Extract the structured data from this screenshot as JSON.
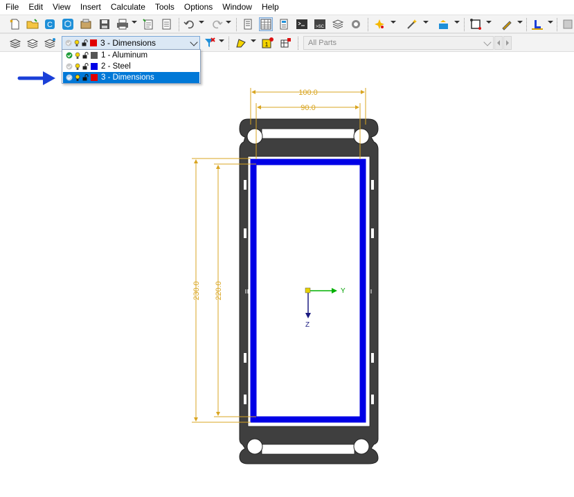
{
  "menu": [
    "File",
    "Edit",
    "View",
    "Insert",
    "Calculate",
    "Tools",
    "Options",
    "Window",
    "Help"
  ],
  "layer_combo": {
    "selected_label": "3 - Dimensions",
    "selected_color": "#e00000"
  },
  "layers": [
    {
      "label": "1 - Aluminum",
      "color": "#555555",
      "visible": true,
      "selected": false
    },
    {
      "label": "2 - Steel",
      "color": "#0000e6",
      "visible": false,
      "selected": false
    },
    {
      "label": "3 - Dimensions",
      "color": "#e00000",
      "visible": false,
      "selected": true
    }
  ],
  "parts_combo": {
    "value": "All Parts"
  },
  "dimensions": {
    "outer_width": "100.0",
    "inner_width": "90.0",
    "outer_height": "230.0",
    "inner_height": "220.0"
  },
  "axes": {
    "horizontal": "Y",
    "vertical": "Z"
  },
  "colors": {
    "steel": "#0000e6",
    "aluminum": "#3f3f3f",
    "dimension": "#d9a521",
    "arrow": "#1a3fd8"
  }
}
